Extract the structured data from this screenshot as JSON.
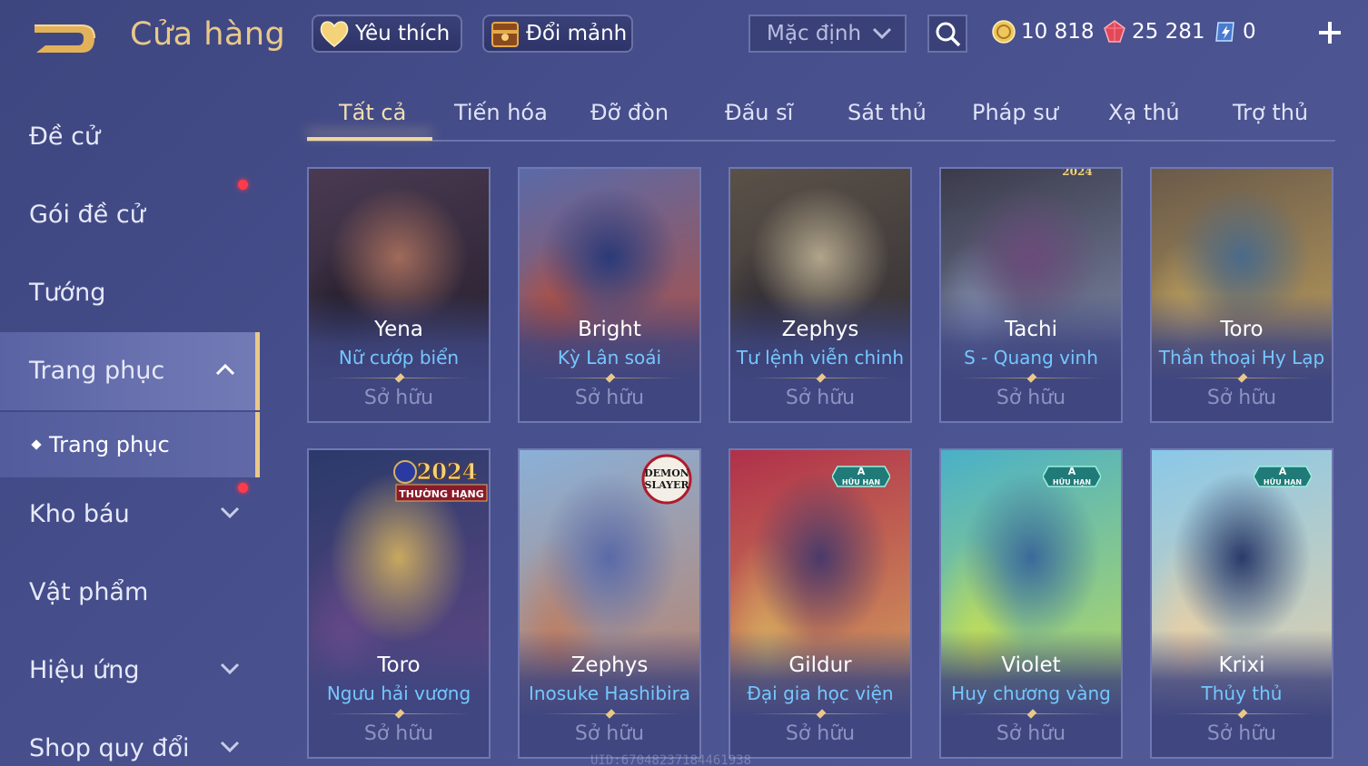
{
  "header": {
    "title": "Cửa hàng",
    "favorites_label": "Yêu thích",
    "exchange_label": "Đổi mảnh",
    "sort_value": "Mặc định",
    "currencies": [
      {
        "name": "gold",
        "value": "10 818",
        "icon": "gold-coin-icon",
        "color": "#f0c75e"
      },
      {
        "name": "ruby",
        "value": "25 281",
        "icon": "ruby-icon",
        "color": "#e2475a"
      },
      {
        "name": "voucher",
        "value": "0",
        "icon": "voucher-icon",
        "color": "#8fc8ff"
      }
    ]
  },
  "sidebar": {
    "items": [
      {
        "label": "Đề cử",
        "has_dot": false
      },
      {
        "label": "Gói đề cử",
        "has_dot": true
      },
      {
        "label": "Tướng",
        "has_dot": false
      },
      {
        "label": "Trang phục",
        "active": true,
        "expanded": true
      },
      {
        "label": "Kho báu",
        "has_dot": true
      },
      {
        "label": "Vật phẩm"
      },
      {
        "label": "Hiệu ứng"
      },
      {
        "label": "Shop quy đổi"
      }
    ],
    "sub_item": "Trang phục"
  },
  "tabs": [
    "Tất cả",
    "Tiến hóa",
    "Đỡ đòn",
    "Đấu sĩ",
    "Sát thủ",
    "Pháp sư",
    "Xạ thủ",
    "Trợ thủ"
  ],
  "active_tab": "Tất cả",
  "cards": [
    {
      "hero": "Yena",
      "skin": "Nữ cướp biển",
      "status": "Sở hữu",
      "palette": [
        "#4a3a52",
        "#1f1a26",
        "#a06a5a"
      ]
    },
    {
      "hero": "Bright",
      "skin": "Kỳ Lân soái",
      "status": "Sở hữu",
      "palette": [
        "#5a6aa8",
        "#c04a2e",
        "#2a3a78"
      ]
    },
    {
      "hero": "Zephys",
      "skin": "Tư lệnh viễn chinh",
      "status": "Sở hữu",
      "palette": [
        "#5a5248",
        "#2a2630",
        "#b0a48a"
      ]
    },
    {
      "hero": "Tachi",
      "skin": "S - Quang vinh",
      "status": "Sở hữu",
      "palette": [
        "#3a3a4a",
        "#8a96b8",
        "#6a4a7a"
      ]
    },
    {
      "hero": "Toro",
      "skin": "Thần thoại Hy Lạp",
      "status": "Sở hữu",
      "palette": [
        "#6a5a4a",
        "#c8a860",
        "#4a6a8a"
      ]
    },
    {
      "hero": "Toro",
      "skin": "Ngưu hải vương",
      "status": "Sở hữu",
      "palette": [
        "#2a3a6a",
        "#6a4a8a",
        "#c8a860"
      ]
    },
    {
      "hero": "Zephys",
      "skin": "Inosuke Hashibira",
      "status": "Sở hữu",
      "palette": [
        "#8ab0d8",
        "#c07a5a",
        "#5a6aa8"
      ]
    },
    {
      "hero": "Gildur",
      "skin": "Đại gia học viện",
      "status": "Sở hữu",
      "palette": [
        "#b0304a",
        "#d8b060",
        "#4a3a6a"
      ]
    },
    {
      "hero": "Violet",
      "skin": "Huy chương vàng",
      "status": "Sở hữu",
      "palette": [
        "#4ab0c8",
        "#c8e050",
        "#3a6a9a"
      ]
    },
    {
      "hero": "Krixi",
      "skin": "Thủy thủ",
      "status": "Sở hữu",
      "palette": [
        "#8ac8e8",
        "#f0d0a0",
        "#2a3a6a"
      ]
    }
  ],
  "badges": {
    "rank_year": "2024",
    "rank_label": "THƯỜNG HẠNG",
    "collab_label": "DEMON SLAYER",
    "limited_grade": "A",
    "limited_label": "HỮU HẠN",
    "card4_year": "2024"
  },
  "footer_uid": "UID:67048237184461938"
}
